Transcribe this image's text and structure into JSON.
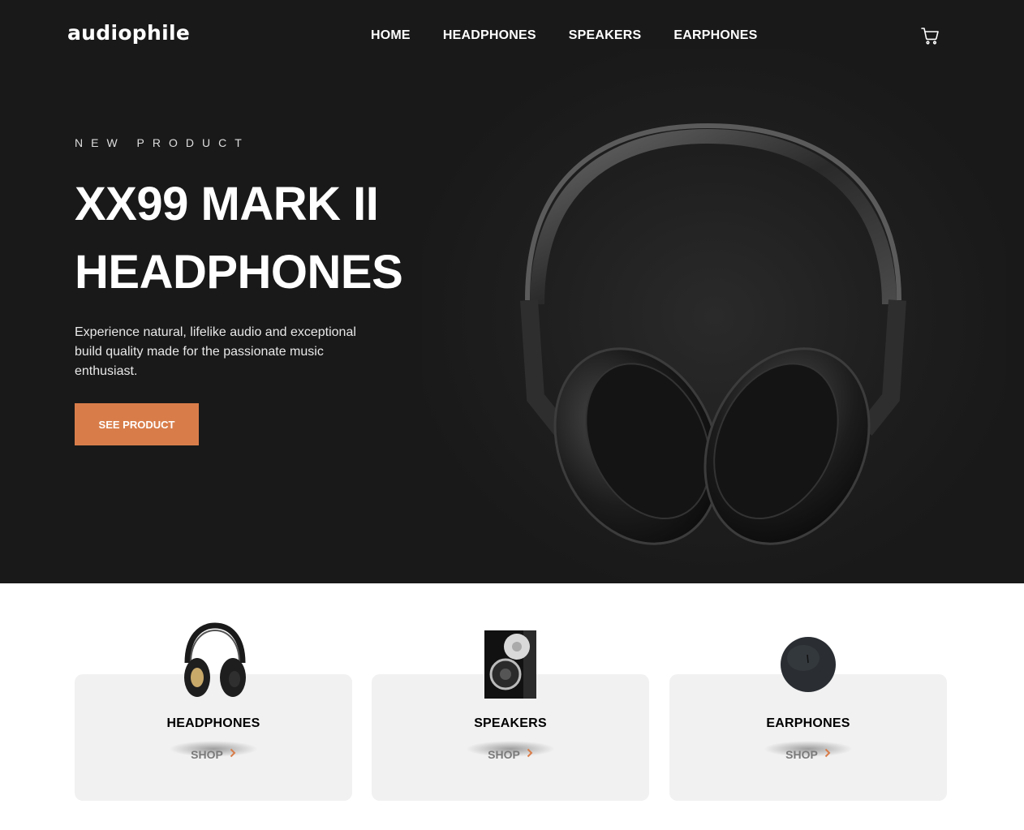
{
  "brand": {
    "logo_text": "audiophile"
  },
  "nav": {
    "items": [
      {
        "label": "HOME"
      },
      {
        "label": "HEADPHONES"
      },
      {
        "label": "SPEAKERS"
      },
      {
        "label": "EARPHONES"
      }
    ],
    "cart_icon": "cart-icon"
  },
  "hero": {
    "overline": "NEW PRODUCT",
    "title_line1": "XX99 MARK II",
    "title_line2": "HEADPHONES",
    "description": "Experience natural, lifelike audio and exceptional build quality made for the passionate music enthusiast.",
    "cta_label": "SEE PRODUCT",
    "accent_color": "#d87d4a"
  },
  "categories": [
    {
      "title": "HEADPHONES",
      "shop_label": "SHOP"
    },
    {
      "title": "SPEAKERS",
      "shop_label": "SHOP"
    },
    {
      "title": "EARPHONES",
      "shop_label": "SHOP"
    }
  ]
}
